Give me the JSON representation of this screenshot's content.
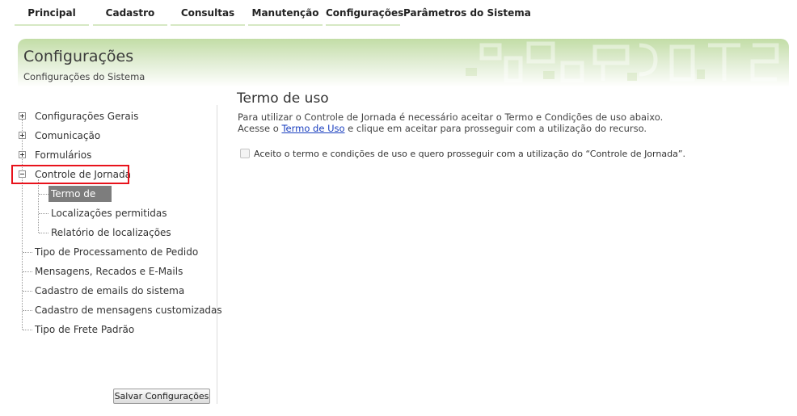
{
  "nav": {
    "items": [
      "Principal",
      "Cadastro",
      "Consultas",
      "Manutenção",
      "Configurações",
      "Parâmetros do Sistema"
    ]
  },
  "header": {
    "title": "Configurações",
    "subtitle": "Configurações do Sistema"
  },
  "sidebar": {
    "tree": [
      "Configurações Gerais",
      "Comunicação",
      "Formulários",
      "Controle de Jornada",
      "Tipo de Processamento de Pedido",
      "Mensagens, Recados e E-Mails",
      "Cadastro de emails do sistema",
      "Cadastro de mensagens customizadas",
      "Tipo de Frete Padrão"
    ],
    "children": [
      "Termo de uso",
      "Localizações permitidas",
      "Relatório de localizações"
    ],
    "save_label": "Salvar Configurações"
  },
  "content": {
    "title": "Termo de uso",
    "line1": "Para utilizar o Controle de Jornada é necessário aceitar o Termo e Condições de uso abaixo.",
    "line2_pre": "Acesse o ",
    "line2_link": "Termo de Uso",
    "line2_post": " e clique em aceitar para prosseguir com a utilização do recurso.",
    "checkbox_label": "Aceito o termo e condições de uso e quero prosseguir com a utilização do “Controle de Jornada”."
  }
}
